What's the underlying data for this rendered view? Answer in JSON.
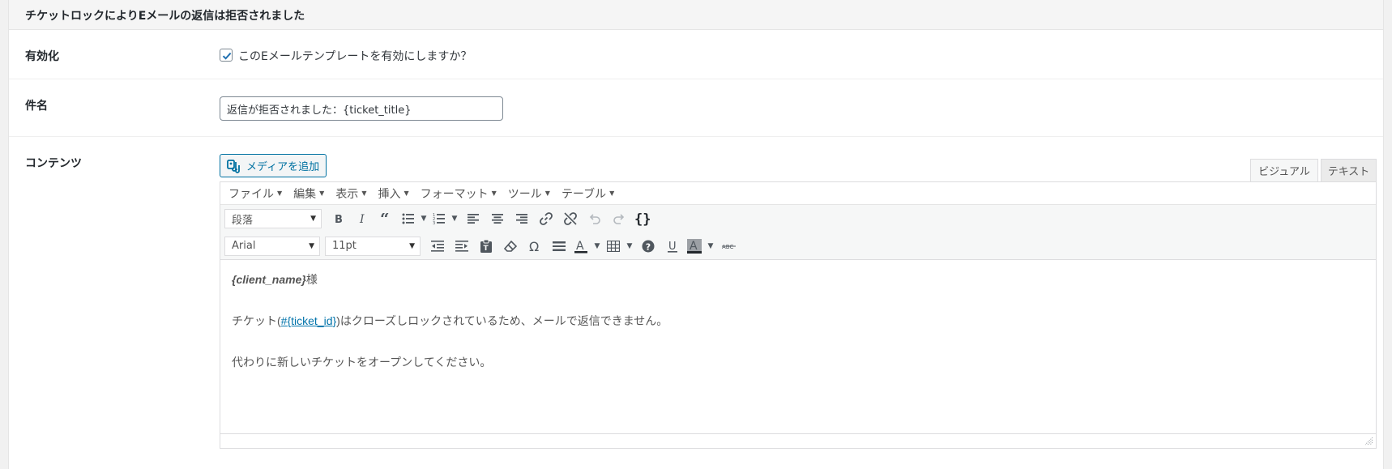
{
  "panel": {
    "title": "チケットロックによりEメールの返信は拒否されました"
  },
  "fields": {
    "enable": {
      "label": "有効化",
      "checked": true,
      "checkbox_text": "このEメールテンプレートを有効にしますか？"
    },
    "subject": {
      "label": "件名",
      "value": "返信が拒否されました：{ticket_title}"
    },
    "content": {
      "label": "コンテンツ",
      "add_media_label": "メディアを追加",
      "tabs": [
        "ビジュアル",
        "テキスト"
      ],
      "active_tab": "ビジュアル"
    }
  },
  "editor": {
    "menubar": [
      "ファイル",
      "編集",
      "表示",
      "挿入",
      "フォーマット",
      "ツール",
      "テーブル"
    ],
    "toolbar1": {
      "format_select": "段落",
      "buttons": [
        "bold-icon",
        "italic-icon",
        "blockquote-icon",
        "bullet-list-icon",
        "numbered-list-icon",
        "align-left-icon",
        "align-center-icon",
        "align-right-icon",
        "link-icon",
        "unlink-icon",
        "undo-icon",
        "redo-icon",
        "code-braces-icon"
      ]
    },
    "toolbar2": {
      "font_select": "Arial",
      "size_select": "11pt",
      "buttons": [
        "outdent-icon",
        "indent-icon",
        "paste-text-icon",
        "clear-formatting-icon",
        "special-character-icon",
        "horizontal-rule-icon",
        "text-color-icon",
        "table-icon",
        "help-icon",
        "underline-icon",
        "background-color-icon",
        "strikethrough-icon"
      ]
    },
    "body": {
      "line1_var": "{client_name}",
      "line1_suffix": "様",
      "line2_prefix": "チケット(",
      "line2_link": "#{ticket_id}",
      "line2_suffix": ")はクローズしロックされているため、メールで返信できません。",
      "line3": "代わりに新しいチケットをオープンしてください。"
    }
  },
  "colors": {
    "accent": "#0071a1",
    "link": "#0073aa"
  }
}
